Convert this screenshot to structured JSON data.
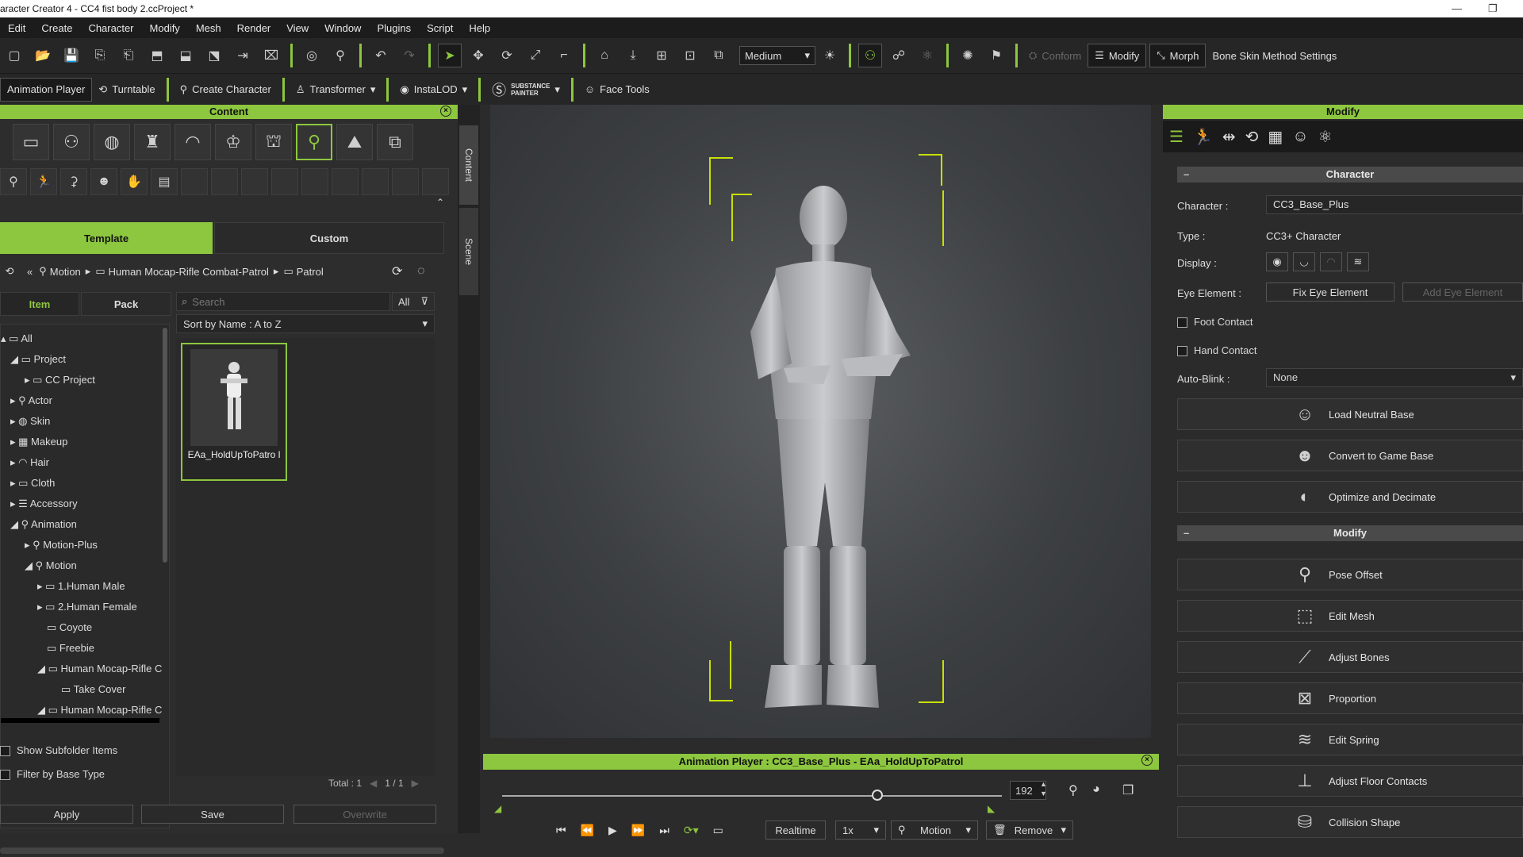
{
  "titlebar": {
    "title": "aracter Creator 4 - CC4 fist body 2.ccProject *"
  },
  "menu": [
    "Edit",
    "Create",
    "Character",
    "Modify",
    "Mesh",
    "Render",
    "View",
    "Window",
    "Plugins",
    "Script",
    "Help"
  ],
  "toolbar1": {
    "quality": "Medium",
    "conform": "Conform",
    "modify": "Modify",
    "morph": "Morph",
    "bone_skin": "Bone Skin Method Settings"
  },
  "toolbar2": {
    "animation_player": "Animation Player",
    "turntable": "Turntable",
    "create_character": "Create Character",
    "transformer": "Transformer",
    "instalod": "InstaLOD",
    "substance": "SUBSTANCE",
    "painter": "PAINTER",
    "face_tools": "Face Tools"
  },
  "content": {
    "title": "Content",
    "tabs": {
      "template": "Template",
      "custom": "Custom"
    },
    "breadcrumb": [
      "Motion",
      "Human Mocap-Rifle Combat-Patrol",
      "Patrol"
    ],
    "subtabs": {
      "item": "Item",
      "pack": "Pack"
    },
    "search_placeholder": "Search",
    "filter_all": "All",
    "sort": "Sort by Name : A to Z",
    "tree": [
      "All",
      "Project",
      "CC Project",
      "Actor",
      "Skin",
      "Makeup",
      "Hair",
      "Cloth",
      "Accessory",
      "Animation",
      "Motion-Plus",
      "Motion",
      "1.Human Male",
      "2.Human Female",
      "Coyote",
      "Freebie",
      "Human Mocap-Rifle C",
      "Take Cover",
      "Human Mocap-Rifle C"
    ],
    "thumb_label": "EAa_HoldUpToPatro l",
    "show_subfolder": "Show Subfolder Items",
    "filter_base": "Filter by Base Type",
    "total": "Total : 1",
    "page": "1  /  1",
    "apply": "Apply",
    "save": "Save",
    "overwrite": "Overwrite"
  },
  "vtabs": {
    "content": "Content",
    "scene": "Scene"
  },
  "anim": {
    "title": "Animation Player : CC3_Base_Plus - EAa_HoldUpToPatrol",
    "frame": "192",
    "realtime": "Realtime",
    "speed": "1x",
    "motion": "Motion",
    "remove": "Remove",
    "progress": 0.75
  },
  "modify": {
    "title": "Modify",
    "character_section": "Character",
    "character_label": "Character :",
    "character_value": "CC3_Base_Plus",
    "type_label": "Type :",
    "type_value": "CC3+ Character",
    "display_label": "Display :",
    "eye_label": "Eye Element :",
    "fix_eye": "Fix Eye Element",
    "add_eye": "Add Eye Element",
    "foot_contact": "Foot Contact",
    "hand_contact": "Hand Contact",
    "autoblink_label": "Auto-Blink :",
    "autoblink_value": "None",
    "buttons1": [
      "Load Neutral Base",
      "Convert to Game Base",
      "Optimize and Decimate"
    ],
    "modify_section": "Modify",
    "buttons2": [
      "Pose Offset",
      "Edit Mesh",
      "Adjust Bones",
      "Proportion",
      "Edit Spring",
      "Adjust Floor Contacts",
      "Collision Shape"
    ]
  },
  "accent": "#8dc63f"
}
